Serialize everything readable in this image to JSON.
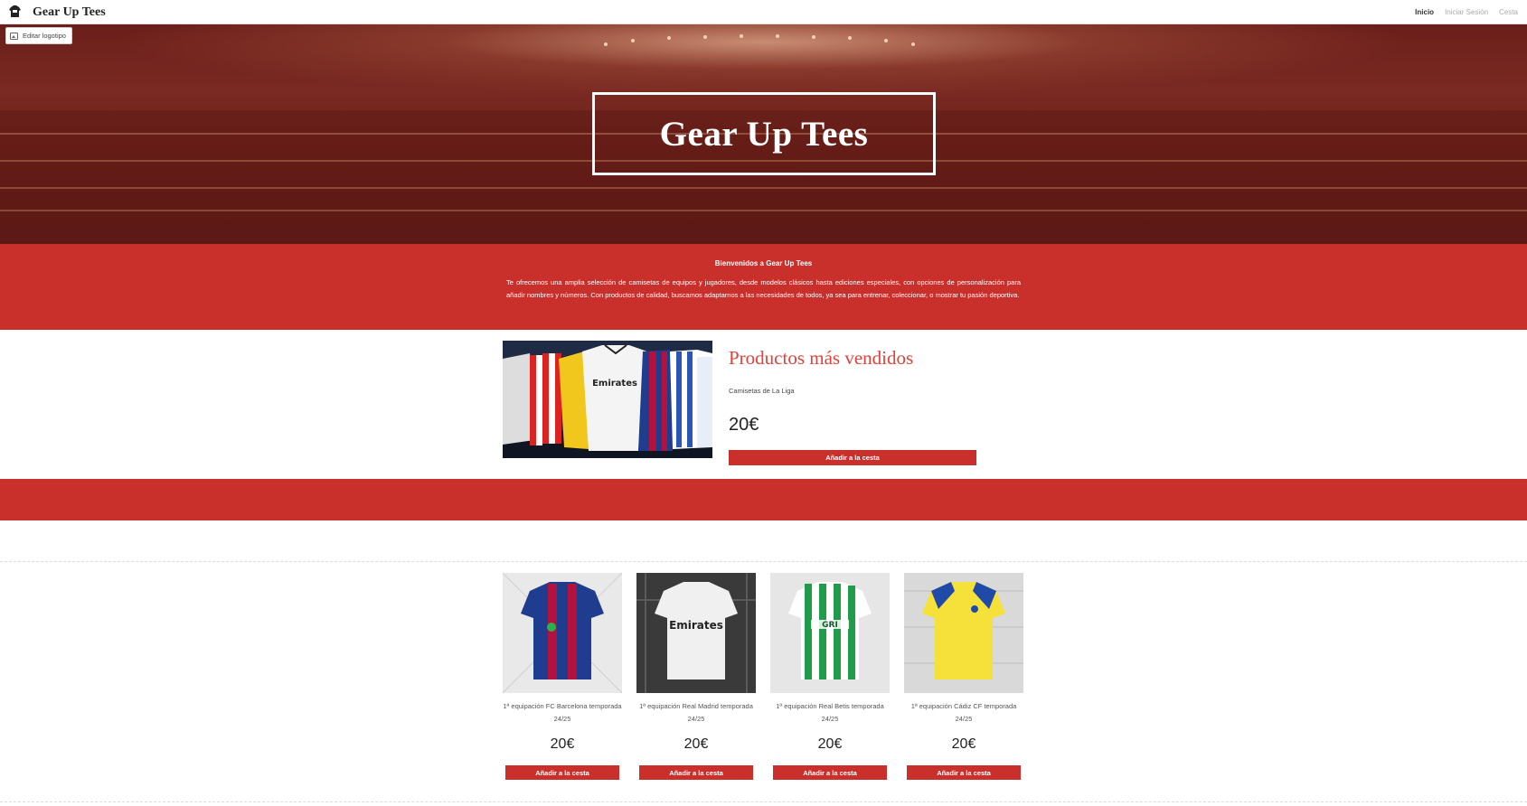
{
  "nav": {
    "brand": "Gear Up Tees",
    "links": [
      "Inicio",
      "Iniciar Sesión",
      "Cesta"
    ]
  },
  "edit_logo": "Editar logotipo",
  "hero": {
    "title": "Gear Up Tees"
  },
  "welcome": {
    "heading": "Bienvenidos a Gear Up Tees",
    "text": "Te ofrecemos una amplia selección de camisetas de equipos y jugadores, desde modelos clásicos hasta ediciones especiales, con opciones de personalización para añadir nombres y números. Con productos de calidad, buscamos adaptarnos a las necesidades de todos, ya sea para entrenar, coleccionar, o mostrar tu pasión deportiva."
  },
  "featured": {
    "title": "Productos más vendidos",
    "subtitle": "Camisetas de La Liga",
    "price": "20€",
    "button": "Añadir a la cesta"
  },
  "products": [
    {
      "name": "1ª equipación FC Barcelona temporada 24/25",
      "price": "20€",
      "button": "Añadir a la cesta"
    },
    {
      "name": "1ª equipación Real Madrid temporada 24/25",
      "price": "20€",
      "button": "Añadir a la cesta"
    },
    {
      "name": "1ª equipación Real Betis temporada 24/25",
      "price": "20€",
      "button": "Añadir a la cesta"
    },
    {
      "name": "1ª equipación Cádiz CF temporada 24/25",
      "price": "20€",
      "button": "Añadir a la cesta"
    }
  ],
  "colors": {
    "accent": "#c9302c",
    "title_red": "#e0413a",
    "hero_dark": "#6b1e1a"
  }
}
